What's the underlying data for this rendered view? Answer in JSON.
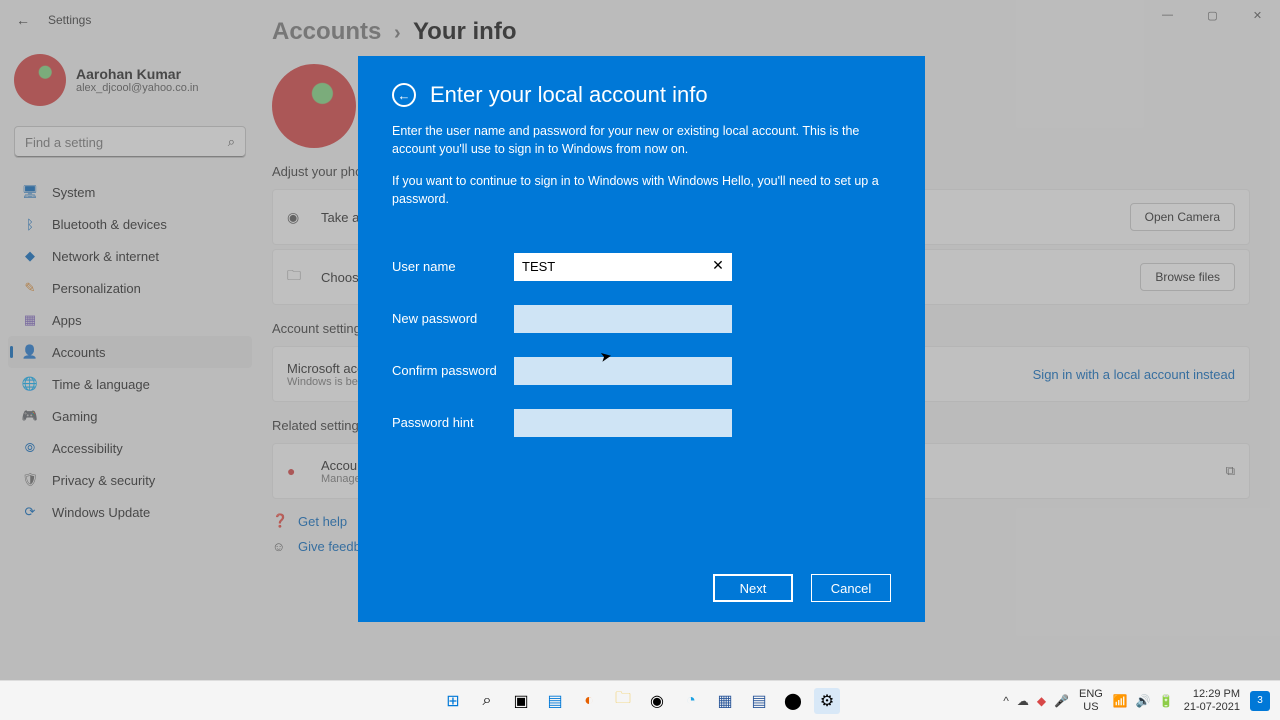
{
  "window": {
    "title": "Settings"
  },
  "user": {
    "name": "Aarohan Kumar",
    "email": "alex_djcool@yahoo.co.in"
  },
  "search": {
    "placeholder": "Find a setting"
  },
  "nav": {
    "items": [
      {
        "label": "System"
      },
      {
        "label": "Bluetooth & devices"
      },
      {
        "label": "Network & internet"
      },
      {
        "label": "Personalization"
      },
      {
        "label": "Apps"
      },
      {
        "label": "Accounts"
      },
      {
        "label": "Time & language"
      },
      {
        "label": "Gaming"
      },
      {
        "label": "Accessibility"
      },
      {
        "label": "Privacy & security"
      },
      {
        "label": "Windows Update"
      }
    ]
  },
  "breadcrumb": {
    "parent": "Accounts",
    "current": "Your info"
  },
  "sections": {
    "adjust_photo": "Adjust your photo",
    "take_photo": "Take a photo",
    "choose_file": "Choose a file",
    "open_camera": "Open Camera",
    "browse_files": "Browse files",
    "account_settings": "Account settings",
    "ms_account": "Microsoft account",
    "ms_account_sub": "Windows is better when",
    "sign_in_local": "Sign in with a local account instead",
    "related": "Related settings",
    "accounts_row": "Accounts",
    "accounts_row_sub": "Manage",
    "get_help": "Get help",
    "give_feedback": "Give feedback"
  },
  "modal": {
    "title": "Enter your local account info",
    "desc1": "Enter the user name and password for your new or existing local account. This is the account you'll use to sign in to Windows from now on.",
    "desc2": "If you want to continue to sign in to Windows with Windows Hello, you'll need to set up a password.",
    "labels": {
      "username": "User name",
      "new_password": "New password",
      "confirm_password": "Confirm password",
      "password_hint": "Password hint"
    },
    "values": {
      "username": "TEST"
    },
    "buttons": {
      "next": "Next",
      "cancel": "Cancel"
    }
  },
  "taskbar": {
    "lang": "ENG",
    "lang_sub": "US",
    "time": "12:29 PM",
    "date": "21-07-2021",
    "notif_count": "3"
  }
}
